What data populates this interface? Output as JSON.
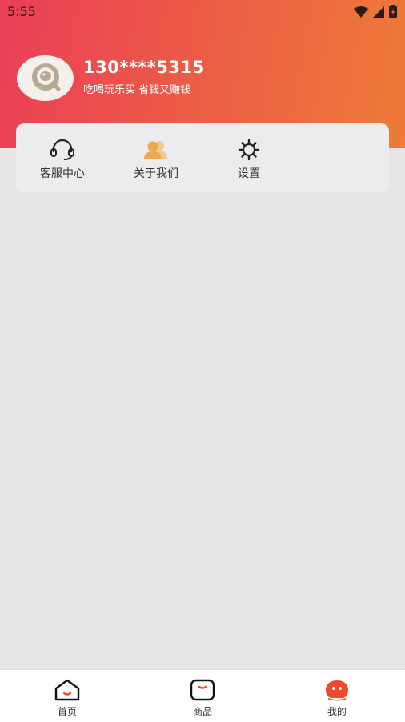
{
  "status_bar": {
    "time": "5:55",
    "icons": [
      "wifi-icon",
      "signal-icon",
      "battery-icon"
    ]
  },
  "profile": {
    "phone": "130****5315",
    "slogan": "吃喝玩乐买 省钱又赚钱",
    "avatar_icon": "avatar-logo-icon"
  },
  "menu": {
    "items": [
      {
        "label": "客服中心",
        "icon": "headset-icon"
      },
      {
        "label": "关于我们",
        "icon": "about-us-icon"
      },
      {
        "label": "设置",
        "icon": "gear-icon"
      }
    ]
  },
  "tab_bar": {
    "items": [
      {
        "label": "首页",
        "icon": "home-icon",
        "active": false
      },
      {
        "label": "商品",
        "icon": "goods-icon",
        "active": false
      },
      {
        "label": "我的",
        "icon": "profile-icon",
        "active": true
      }
    ]
  },
  "colors": {
    "header_gradient_start": "#ea3e58",
    "header_gradient_end": "#ee7b38",
    "accent": "#f04a2a",
    "background": "#e6e6e6"
  }
}
